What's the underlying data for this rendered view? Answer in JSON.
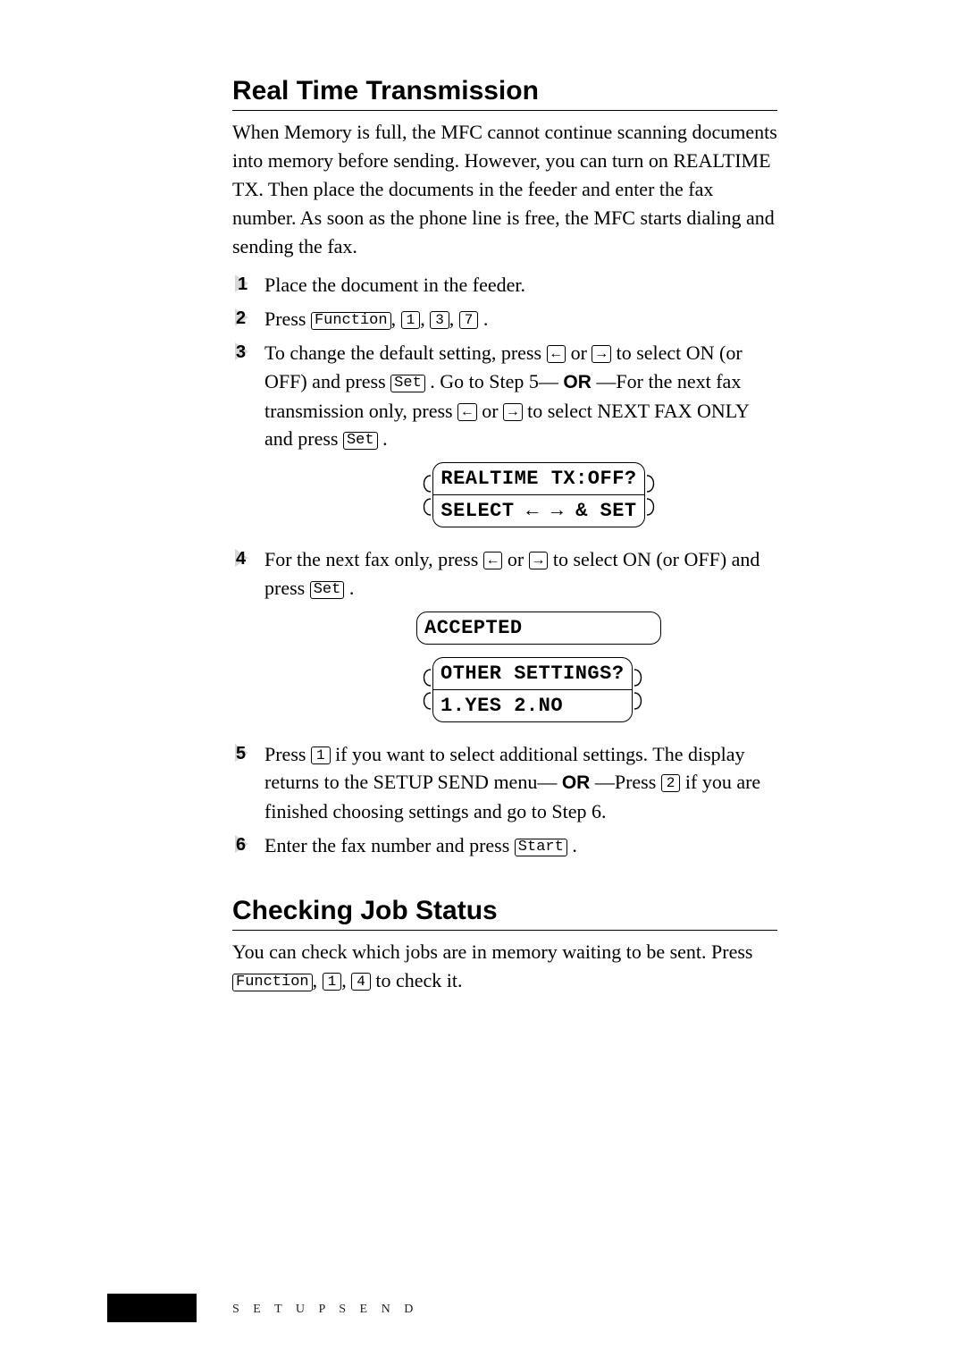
{
  "section1": {
    "heading": "Real Time Transmission",
    "intro": "When Memory is full, the MFC cannot continue scanning documents into memory before sending. However, you can turn on REALTIME TX. Then place the documents in the feeder and enter the fax number. As soon as the phone line is free, the MFC starts dialing and sending the fax.",
    "step1": "Place the document in the feeder.",
    "step2_a": "Press ",
    "step2_b": " .",
    "step3_a": "To change the default setting, press ",
    "step3_b": " or ",
    "step3_c": " to select ON (or OFF) and press ",
    "step3_d": ". Go to Step 5—",
    "step3_e": "—For the next fax transmission only, press ",
    "step3_f": " or ",
    "step3_g": " to select NEXT FAX ONLY and press ",
    "step3_h": ".",
    "lcd1_line1": "REALTIME TX:OFF?",
    "lcd1_line2": "SELECT ← → & SET",
    "step4_a": "For the next fax only, press ",
    "step4_b": " or ",
    "step4_c": " to select ON (or OFF) and press ",
    "step4_d": ".",
    "lcd2": "ACCEPTED        ",
    "lcd3_line1": "OTHER SETTINGS?",
    "lcd3_line2": "1.YES 2.NO     ",
    "step5_a": "Press ",
    "step5_b": " if you want to select additional settings. The display returns to the SETUP SEND menu—",
    "step5_c": "—Press   ",
    "step5_d": " if you are finished choosing settings and go to Step 6.",
    "step6_a": "Enter the fax number and press ",
    "step6_b": "."
  },
  "section2": {
    "heading": "Checking Job Status",
    "body_a": "You can check which jobs are in memory waiting to be sent. Press ",
    "body_b": " to check it."
  },
  "keys": {
    "function": "Function",
    "set": "Set",
    "start": "Start",
    "left": "←",
    "right": "→",
    "k1": "1",
    "k2": "2",
    "k3": "3",
    "k4": "4",
    "k7": "7"
  },
  "or": "OR",
  "footer": "S E T U P   S E N D"
}
